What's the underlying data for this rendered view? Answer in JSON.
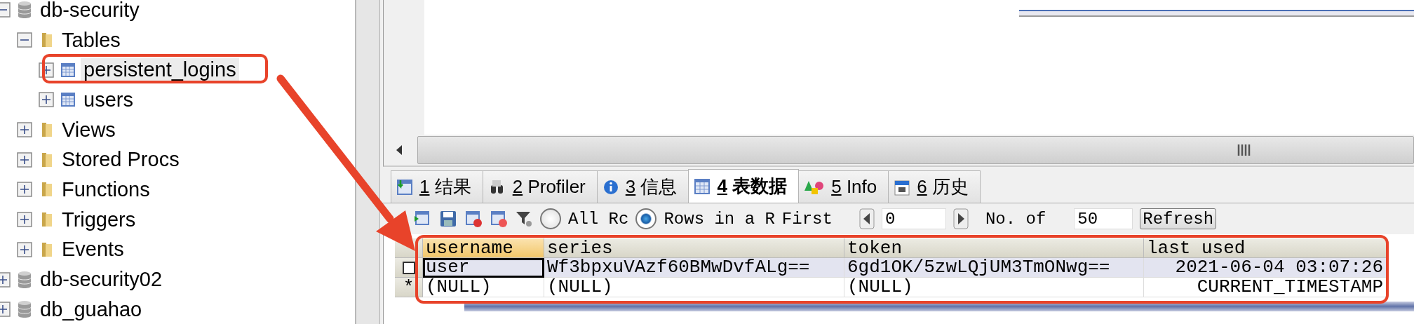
{
  "tree": [
    {
      "kind": "database",
      "label": "db-security",
      "expanded": true,
      "selected": false,
      "children": [
        {
          "kind": "folder",
          "label": "Tables",
          "expanded": true,
          "selected": false,
          "children": [
            {
              "kind": "table",
              "label": "persistent_logins",
              "expanded": false,
              "selected": true
            },
            {
              "kind": "table",
              "label": "users",
              "expanded": false,
              "selected": false
            }
          ]
        },
        {
          "kind": "folder",
          "label": "Views",
          "expanded": false,
          "selected": false
        },
        {
          "kind": "folder",
          "label": "Stored Procs",
          "expanded": false,
          "selected": false
        },
        {
          "kind": "folder",
          "label": "Functions",
          "expanded": false,
          "selected": false
        },
        {
          "kind": "folder",
          "label": "Triggers",
          "expanded": false,
          "selected": false
        },
        {
          "kind": "folder",
          "label": "Events",
          "expanded": false,
          "selected": false
        }
      ]
    },
    {
      "kind": "database",
      "label": "db-security02",
      "expanded": false,
      "selected": false
    },
    {
      "kind": "database",
      "label": "db_guahao",
      "expanded": false,
      "selected": false
    }
  ],
  "tabs": [
    {
      "kind": "result",
      "number": "1",
      "label": "结果",
      "selected": false
    },
    {
      "kind": "profiler",
      "number": "2",
      "label": "Profiler",
      "selected": false
    },
    {
      "kind": "info",
      "number": "3",
      "label": "信息",
      "selected": false
    },
    {
      "kind": "table",
      "number": "4",
      "label": "表数据",
      "selected": true
    },
    {
      "kind": "shapes",
      "number": "5",
      "label": "Info",
      "selected": false
    },
    {
      "kind": "calendar",
      "number": "6",
      "label": "历史",
      "selected": false
    }
  ],
  "toolbar": {
    "radios": [
      {
        "label": "All Rc",
        "selected": false
      },
      {
        "label": "Rows in a R",
        "selected": true
      }
    ],
    "first_label": "First",
    "first_value": "0",
    "count_label": "No. of",
    "count_value": "50",
    "refresh": "Refresh"
  },
  "grid": {
    "columns": [
      {
        "label": "username",
        "selected": true
      },
      {
        "label": "series",
        "selected": false
      },
      {
        "label": "token",
        "selected": false
      },
      {
        "label": "last used",
        "selected": false
      }
    ],
    "rows": [
      {
        "kind": "data",
        "checked": false,
        "cells": [
          {
            "text": "user",
            "current": true
          },
          {
            "text": "Wf3bpxuVAzf60BMwDvfALg==",
            "current": false
          },
          {
            "text": "6gd1OK/5zwLQjUM3TmONwg==",
            "current": false
          },
          {
            "text": "2021-06-04 03:07:26",
            "current": false
          }
        ]
      },
      {
        "kind": "new",
        "marker": "*",
        "cells": [
          {
            "text": "(NULL)",
            "current": false
          },
          {
            "text": "(NULL)",
            "current": false
          },
          {
            "text": "(NULL)",
            "current": false
          },
          {
            "text": "CURRENT_TIMESTAMP",
            "current": false
          }
        ]
      }
    ]
  }
}
